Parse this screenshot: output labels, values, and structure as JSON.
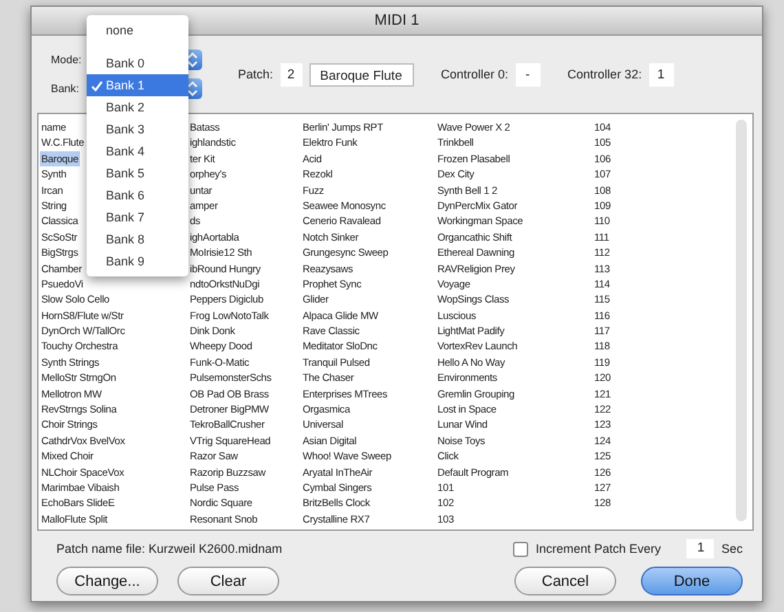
{
  "window": {
    "title": "MIDI 1"
  },
  "mode": {
    "label": "Mode:"
  },
  "bank": {
    "label": "Bank:"
  },
  "bank_menu": {
    "items": [
      {
        "label": "none",
        "kind": "item",
        "selected": false
      },
      {
        "kind": "separator"
      },
      {
        "label": "Bank 0",
        "kind": "item",
        "selected": false
      },
      {
        "label": "Bank 1",
        "kind": "item",
        "selected": true
      },
      {
        "label": "Bank 2",
        "kind": "item",
        "selected": false
      },
      {
        "label": "Bank 3",
        "kind": "item",
        "selected": false
      },
      {
        "label": "Bank 4",
        "kind": "item",
        "selected": false
      },
      {
        "label": "Bank 5",
        "kind": "item",
        "selected": false
      },
      {
        "label": "Bank 6",
        "kind": "item",
        "selected": false
      },
      {
        "label": "Bank 7",
        "kind": "item",
        "selected": false
      },
      {
        "label": "Bank 8",
        "kind": "item",
        "selected": false
      },
      {
        "label": "Bank 9",
        "kind": "item",
        "selected": false
      }
    ]
  },
  "patch": {
    "label": "Patch:",
    "number": "2",
    "name": "Baroque Flute"
  },
  "controller_0": {
    "label": "Controller 0:",
    "value": "-"
  },
  "controller_32": {
    "label": "Controller 32:",
    "value": "1"
  },
  "patch_list": {
    "columns": [
      [
        {
          "text": "name",
          "selected": false
        },
        {
          "text": "W.C.Flute",
          "selected": false
        },
        {
          "text": "Baroque",
          "selected": true
        },
        {
          "text": "Synth",
          "selected": false
        },
        {
          "text": "Ircan",
          "selected": false
        },
        {
          "text": "String",
          "selected": false
        },
        {
          "text": "Classica",
          "selected": false
        },
        {
          "text": "ScSoStr",
          "selected": false
        },
        {
          "text": "BigStrgs",
          "selected": false
        },
        {
          "text": "Chamber",
          "selected": false
        },
        {
          "text": "PsuedoVi",
          "selected": false
        },
        {
          "text": "Slow Solo Cello",
          "selected": false
        },
        {
          "text": "HornS8/Flute w/Str",
          "selected": false
        },
        {
          "text": "DynOrch W/TallOrc",
          "selected": false
        },
        {
          "text": "Touchy Orchestra",
          "selected": false
        },
        {
          "text": "Synth Strings",
          "selected": false
        },
        {
          "text": "MelloStr StrngOn",
          "selected": false
        },
        {
          "text": "Mellotron MW",
          "selected": false
        },
        {
          "text": "RevStrngs Solina",
          "selected": false
        },
        {
          "text": "Choir Strings",
          "selected": false
        },
        {
          "text": "CathdrVox BvelVox",
          "selected": false
        },
        {
          "text": "Mixed Choir",
          "selected": false
        },
        {
          "text": "NLChoir SpaceVox",
          "selected": false
        },
        {
          "text": "Marimbae Vibaish",
          "selected": false
        },
        {
          "text": "EchoBars SlideE",
          "selected": false
        },
        {
          "text": "MalloFlute Split",
          "selected": false
        }
      ],
      [
        {
          "text": "Batass",
          "selected": false
        },
        {
          "text": "ighlandstic",
          "selected": false
        },
        {
          "text": "ter Kit",
          "selected": false
        },
        {
          "text": "orphey's",
          "selected": false
        },
        {
          "text": "untar",
          "selected": false
        },
        {
          "text": "amper",
          "selected": false
        },
        {
          "text": "ds",
          "selected": false
        },
        {
          "text": "ighAortabla",
          "selected": false
        },
        {
          "text": "MoIrisie12 Sth",
          "selected": false
        },
        {
          "text": "ibRound Hungry",
          "selected": false
        },
        {
          "text": "ndtoOrkstNuDgi",
          "selected": false
        },
        {
          "text": "Peppers Digiclub",
          "selected": false
        },
        {
          "text": "Frog LowNotoTalk",
          "selected": false
        },
        {
          "text": "Dink Donk",
          "selected": false
        },
        {
          "text": "Wheepy Dood",
          "selected": false
        },
        {
          "text": "Funk-O-Matic",
          "selected": false
        },
        {
          "text": "PulsemonsterSchs",
          "selected": false
        },
        {
          "text": "OB Pad OB Brass",
          "selected": false
        },
        {
          "text": "Detroner BigPMW",
          "selected": false
        },
        {
          "text": "TekroBallCrusher",
          "selected": false
        },
        {
          "text": "VTrig SquareHead",
          "selected": false
        },
        {
          "text": "Razor Saw",
          "selected": false
        },
        {
          "text": "Razorip Buzzsaw",
          "selected": false
        },
        {
          "text": "Pulse Pass",
          "selected": false
        },
        {
          "text": "Nordic Square",
          "selected": false
        },
        {
          "text": "Resonant Snob",
          "selected": false
        }
      ],
      [
        {
          "text": "Berlin' Jumps RPT",
          "selected": false
        },
        {
          "text": "Elektro Funk",
          "selected": false
        },
        {
          "text": "Acid",
          "selected": false
        },
        {
          "text": "Rezokl",
          "selected": false
        },
        {
          "text": "Fuzz",
          "selected": false
        },
        {
          "text": "Seawee Monosync",
          "selected": false
        },
        {
          "text": "Cenerio Ravalead",
          "selected": false
        },
        {
          "text": "Notch Sinker",
          "selected": false
        },
        {
          "text": "Grungesync Sweep",
          "selected": false
        },
        {
          "text": "Reazysaws",
          "selected": false
        },
        {
          "text": "Prophet Sync",
          "selected": false
        },
        {
          "text": "Glider",
          "selected": false
        },
        {
          "text": "Alpaca Glide MW",
          "selected": false
        },
        {
          "text": "Rave Classic",
          "selected": false
        },
        {
          "text": "Meditator SloDnc",
          "selected": false
        },
        {
          "text": "Tranquil Pulsed",
          "selected": false
        },
        {
          "text": "The Chaser",
          "selected": false
        },
        {
          "text": "Enterprises MTrees",
          "selected": false
        },
        {
          "text": "Orgasmica",
          "selected": false
        },
        {
          "text": "Universal",
          "selected": false
        },
        {
          "text": "Asian Digital",
          "selected": false
        },
        {
          "text": "Whoo! Wave Sweep",
          "selected": false
        },
        {
          "text": "Aryatal InTheAir",
          "selected": false
        },
        {
          "text": "Cymbal Singers",
          "selected": false
        },
        {
          "text": "BritzBells Clock",
          "selected": false
        },
        {
          "text": "Crystalline RX7",
          "selected": false
        }
      ],
      [
        {
          "text": "Wave Power X 2",
          "selected": false
        },
        {
          "text": "Trinkbell",
          "selected": false
        },
        {
          "text": "Frozen Plasabell",
          "selected": false
        },
        {
          "text": "Dex City",
          "selected": false
        },
        {
          "text": "Synth Bell 1 2",
          "selected": false
        },
        {
          "text": "DynPercMix Gator",
          "selected": false
        },
        {
          "text": "Workingman Space",
          "selected": false
        },
        {
          "text": "Organcathic Shift",
          "selected": false
        },
        {
          "text": "Ethereal Dawning",
          "selected": false
        },
        {
          "text": "RAVReligion Prey",
          "selected": false
        },
        {
          "text": "Voyage",
          "selected": false
        },
        {
          "text": "WopSings Class",
          "selected": false
        },
        {
          "text": "Luscious",
          "selected": false
        },
        {
          "text": "LightMat Padify",
          "selected": false
        },
        {
          "text": "VortexRev Launch",
          "selected": false
        },
        {
          "text": "Hello A No Way",
          "selected": false
        },
        {
          "text": "Environments",
          "selected": false
        },
        {
          "text": "Gremlin Grouping",
          "selected": false
        },
        {
          "text": "Lost in Space",
          "selected": false
        },
        {
          "text": "Lunar Wind",
          "selected": false
        },
        {
          "text": "Noise Toys",
          "selected": false
        },
        {
          "text": "Click",
          "selected": false
        },
        {
          "text": "Default Program",
          "selected": false
        },
        {
          "text": "101",
          "selected": false
        },
        {
          "text": "102",
          "selected": false
        },
        {
          "text": "103",
          "selected": false
        }
      ],
      [
        {
          "text": "104",
          "selected": false
        },
        {
          "text": "105",
          "selected": false
        },
        {
          "text": "106",
          "selected": false
        },
        {
          "text": "107",
          "selected": false
        },
        {
          "text": "108",
          "selected": false
        },
        {
          "text": "109",
          "selected": false
        },
        {
          "text": "110",
          "selected": false
        },
        {
          "text": "111",
          "selected": false
        },
        {
          "text": "112",
          "selected": false
        },
        {
          "text": "113",
          "selected": false
        },
        {
          "text": "114",
          "selected": false
        },
        {
          "text": "115",
          "selected": false
        },
        {
          "text": "116",
          "selected": false
        },
        {
          "text": "117",
          "selected": false
        },
        {
          "text": "118",
          "selected": false
        },
        {
          "text": "119",
          "selected": false
        },
        {
          "text": "120",
          "selected": false
        },
        {
          "text": "121",
          "selected": false
        },
        {
          "text": "122",
          "selected": false
        },
        {
          "text": "123",
          "selected": false
        },
        {
          "text": "124",
          "selected": false
        },
        {
          "text": "125",
          "selected": false
        },
        {
          "text": "126",
          "selected": false
        },
        {
          "text": "127",
          "selected": false
        },
        {
          "text": "128",
          "selected": false
        }
      ]
    ]
  },
  "patch_name_file": "Patch name file: Kurzweil K2600.midnam",
  "increment": {
    "label": "Increment Patch Every",
    "checked": false,
    "value": "1",
    "unit": "Sec"
  },
  "buttons": [
    {
      "label": "Change...",
      "kind": "normal"
    },
    {
      "label": "Clear",
      "kind": "normal"
    },
    {
      "label": "Cancel",
      "kind": "normal"
    },
    {
      "label": "Done",
      "kind": "default"
    }
  ]
}
